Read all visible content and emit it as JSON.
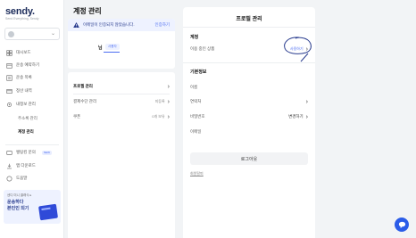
{
  "sidebar": {
    "logo": "sendy.",
    "tagline": "Send Everything, Sendy",
    "nav": [
      {
        "label": "대시보드",
        "icon": "dashboard-icon"
      },
      {
        "label": "운송 예약하기",
        "icon": "calendar-icon"
      },
      {
        "label": "운송 목록",
        "icon": "list-icon"
      },
      {
        "label": "정산 내역",
        "icon": "receipt-icon"
      },
      {
        "label": "내정보 관리",
        "icon": "gear-icon"
      }
    ],
    "sub_items": [
      "주소록 관리",
      "계정 관리"
    ],
    "bottom_nav": [
      {
        "label": "쌩팅킹 문의",
        "icon": "question-icon",
        "badge": "NEW"
      },
      {
        "label": "앱 다운로드",
        "icon": "download-icon"
      },
      {
        "label": "도움말",
        "icon": "help-icon"
      }
    ],
    "promo": {
      "small": "센디 미니 클래식 ▸",
      "title": "운송하다\n본인인 되기"
    }
  },
  "page": {
    "title": "계정 관리"
  },
  "email_card": {
    "banner_text": "이메일이 인증되지 않았습니다.",
    "banner_link": "인증하기",
    "user_name": "님",
    "user_role": "사용자"
  },
  "menu": [
    {
      "label": "프로필 관리",
      "value": ""
    },
    {
      "label": "결제수단 관리",
      "value": "미등록"
    },
    {
      "label": "쿠폰",
      "value": "0개 보유"
    }
  ],
  "profile": {
    "title": "프로필 관리",
    "account_section": "계정",
    "approved_label": "이용 중인 상품",
    "approved_value": "사용하기",
    "basic_section": "기본정보",
    "rows": [
      {
        "label": "이름",
        "value": ""
      },
      {
        "label": "연락처",
        "value": ""
      },
      {
        "label": "비밀번호",
        "value": "변경하기"
      },
      {
        "label": "이메일",
        "value": ""
      }
    ],
    "logout": "로그아웃",
    "withdraw": "회원탈퇴"
  },
  "colors": {
    "accent": "#4b6cf2",
    "brand": "#1b2b5a",
    "chat": "#2b5ce8"
  }
}
